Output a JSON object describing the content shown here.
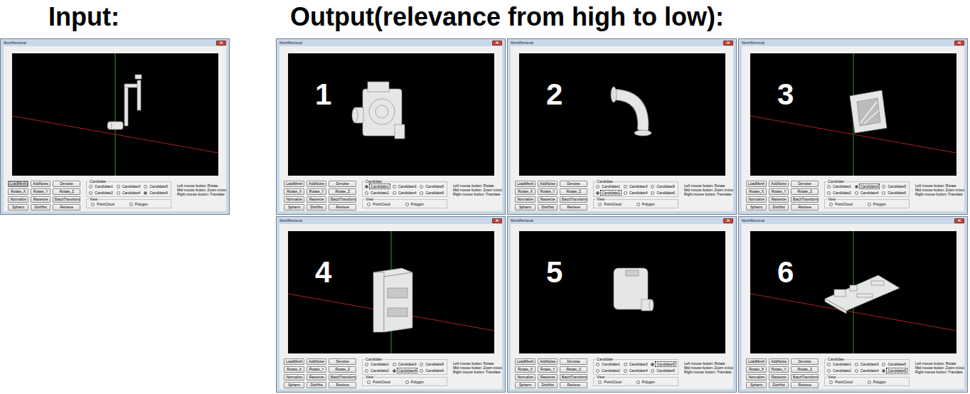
{
  "headings": {
    "input": "Input:",
    "output": "Output(relevance from high to low):"
  },
  "panel": {
    "buttons": [
      "LoadMesh",
      "AddNoise",
      "Denoise",
      "Rotate_X",
      "Rotate_Y",
      "Rotate_Z",
      "Normalize",
      "Rasterize",
      "BatchTransform",
      "Spharm",
      "DistHist",
      "Retrieve"
    ],
    "candidate_title": "Candidate",
    "view_title": "View",
    "view_options": [
      {
        "label": "PointCloud",
        "selected": false
      },
      {
        "label": "Polygon",
        "selected": false
      }
    ],
    "help": [
      "Left mouse button: Rotate",
      "Mid mouse button: Zoom in/out",
      "Right mouse button: Translate"
    ]
  },
  "windows": [
    {
      "title": "MeshRetrieval",
      "number": null,
      "kind": "pipe-bracket",
      "axes": true,
      "focused_button": "LoadMesh",
      "candidate_focused": false,
      "candidates": [
        {
          "label": "Candidate1",
          "selected": false
        },
        {
          "label": "Candidate3",
          "selected": false
        },
        {
          "label": "Candidate5",
          "selected": false
        },
        {
          "label": "Candidate2",
          "selected": false
        },
        {
          "label": "Candidate4",
          "selected": false
        },
        {
          "label": "Candidate6",
          "selected": true
        }
      ]
    },
    {
      "title": "MeshRetrieval",
      "number": "1",
      "kind": "pump",
      "axes": false,
      "focused_button": null,
      "candidate_focused": true,
      "candidates": [
        {
          "label": "Candidate1",
          "selected": true
        },
        {
          "label": "Candidate3",
          "selected": false
        },
        {
          "label": "Candidate5",
          "selected": false
        },
        {
          "label": "Candidate2",
          "selected": false
        },
        {
          "label": "Candidate4",
          "selected": false
        },
        {
          "label": "Candidate6",
          "selected": false
        }
      ]
    },
    {
      "title": "MeshRetrieval",
      "number": "2",
      "kind": "elbow-pipe",
      "axes": false,
      "focused_button": null,
      "candidate_focused": true,
      "candidates": [
        {
          "label": "Candidate1",
          "selected": false
        },
        {
          "label": "Candidate3",
          "selected": false
        },
        {
          "label": "Candidate5",
          "selected": false
        },
        {
          "label": "Candidate2",
          "selected": true
        },
        {
          "label": "Candidate4",
          "selected": false
        },
        {
          "label": "Candidate6",
          "selected": false
        }
      ]
    },
    {
      "title": "MeshRetrieval",
      "number": "3",
      "kind": "panel",
      "axes": true,
      "focused_button": null,
      "candidate_focused": true,
      "candidates": [
        {
          "label": "Candidate1",
          "selected": false
        },
        {
          "label": "Candidate3",
          "selected": true
        },
        {
          "label": "Candidate5",
          "selected": false
        },
        {
          "label": "Candidate2",
          "selected": false
        },
        {
          "label": "Candidate4",
          "selected": false
        },
        {
          "label": "Candidate6",
          "selected": false
        }
      ]
    },
    {
      "title": "MeshRetrieval",
      "number": "4",
      "kind": "mold-block",
      "axes": true,
      "focused_button": null,
      "candidate_focused": true,
      "candidates": [
        {
          "label": "Candidate1",
          "selected": false
        },
        {
          "label": "Candidate3",
          "selected": false
        },
        {
          "label": "Candidate5",
          "selected": false
        },
        {
          "label": "Candidate2",
          "selected": false
        },
        {
          "label": "Candidate4",
          "selected": true
        },
        {
          "label": "Candidate6",
          "selected": false
        }
      ]
    },
    {
      "title": "MeshRetrieval",
      "number": "5",
      "kind": "housing",
      "axes": false,
      "focused_button": null,
      "candidate_focused": true,
      "candidates": [
        {
          "label": "Candidate1",
          "selected": false
        },
        {
          "label": "Candidate3",
          "selected": false
        },
        {
          "label": "Candidate5",
          "selected": true
        },
        {
          "label": "Candidate2",
          "selected": false
        },
        {
          "label": "Candidate4",
          "selected": false
        },
        {
          "label": "Candidate6",
          "selected": false
        }
      ]
    },
    {
      "title": "MeshRetrieval",
      "number": "6",
      "kind": "circuit-board",
      "axes": true,
      "focused_button": null,
      "candidate_focused": true,
      "candidates": [
        {
          "label": "Candidate1",
          "selected": false
        },
        {
          "label": "Candidate3",
          "selected": false
        },
        {
          "label": "Candidate5",
          "selected": false
        },
        {
          "label": "Candidate2",
          "selected": false
        },
        {
          "label": "Candidate4",
          "selected": false
        },
        {
          "label": "Candidate6",
          "selected": true
        }
      ]
    }
  ]
}
